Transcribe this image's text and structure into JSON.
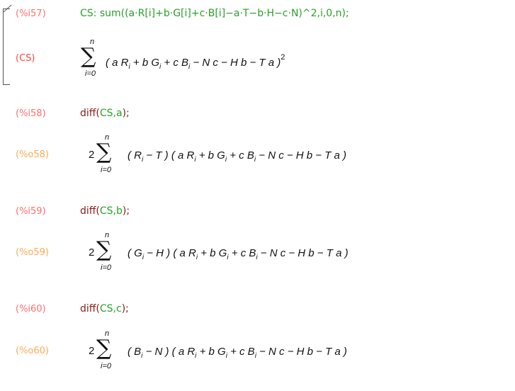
{
  "cells": [
    {
      "input_label": "(%i57)",
      "input_text": "CS: sum((a·R[i]+b·G[i]+c·B[i]−a·T−b·H−c·N)^2,i,0,n);",
      "output_label": "(CS)",
      "output_expr": "(a R_i + b G_i + c B_i − N c − H b − T a)^2",
      "sum_upper": "n",
      "sum_lower": "i=0"
    },
    {
      "input_label": "(%i58)",
      "input_text": "diff(CS,a);",
      "output_label": "(%o58)",
      "coef": "2",
      "output_expr": "(R_i − T) (a R_i + b G_i + c B_i − N c − H b − T a)",
      "sum_upper": "n",
      "sum_lower": "i=0"
    },
    {
      "input_label": "(%i59)",
      "input_text": "diff(CS,b);",
      "output_label": "(%o59)",
      "coef": "2",
      "output_expr": "(G_i − H) (a R_i + b G_i + c B_i − N c − H b − T a)",
      "sum_upper": "n",
      "sum_lower": "i=0"
    },
    {
      "input_label": "(%i60)",
      "input_text": "diff(CS,c);",
      "output_label": "(%o60)",
      "coef": "2",
      "output_expr": "(B_i − N) (a R_i + b G_i + c B_i − N c − H b − T a)",
      "sum_upper": "n",
      "sum_lower": "i=0"
    }
  ],
  "colors": {
    "input_label": "#ff6e6e",
    "output_label": "#ffaa55",
    "cs_label": "#ff4444",
    "input_green": "#2aa02a",
    "input_dark": "#8b1a1a"
  }
}
